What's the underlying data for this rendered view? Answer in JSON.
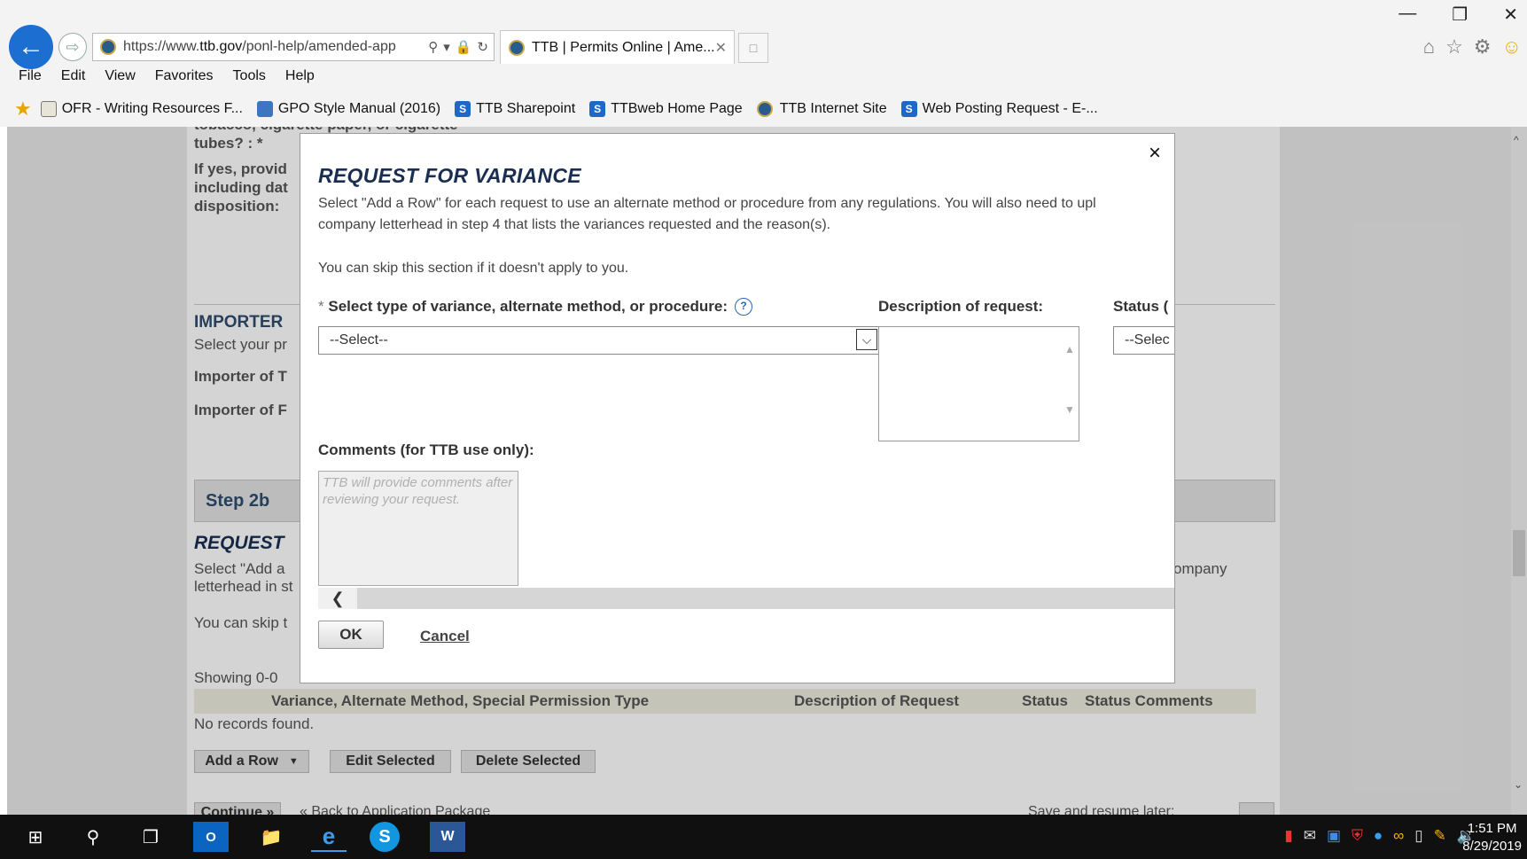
{
  "browser": {
    "url_prefix": "https://www.",
    "url_domain": "ttb.gov",
    "url_rest": "/ponl-help/amended-app",
    "tab_title": "TTB | Permits Online | Ame...",
    "tab_close": "✕",
    "menu": [
      "File",
      "Edit",
      "View",
      "Favorites",
      "Tools",
      "Help"
    ],
    "favorites": [
      {
        "label": "OFR - Writing Resources F...",
        "icon": "document-icon"
      },
      {
        "label": "GPO Style Manual (2016)",
        "icon": "gpo-icon"
      },
      {
        "label": "TTB Sharepoint",
        "icon": "sharepoint-icon"
      },
      {
        "label": "TTBweb Home Page",
        "icon": "sharepoint-icon"
      },
      {
        "label": "TTB Internet Site",
        "icon": "ttb-shield-icon"
      },
      {
        "label": "Web Posting Request - E-...",
        "icon": "sharepoint-icon"
      }
    ]
  },
  "background_page": {
    "q1a": "tobacco, cigarette paper, or cigarette",
    "q1b": "tubes? : *",
    "q2a": "If yes, provid",
    "q2b": "including dat",
    "q2c": "disposition:",
    "importer_heading": "IMPORTER",
    "importer_sub": "Select your pr",
    "importer_t": "Importer of T",
    "importer_f": "Importer of F",
    "step_label": "Step 2b",
    "request_heading": "REQUEST",
    "select_add_a": "Select \"Add a",
    "letterhead_in": "letterhead in st",
    "company_tail": "ompany",
    "skip_frag": "You can skip t",
    "showing": "Showing 0-0",
    "table_headers": [
      "Variance, Alternate Method, Special Permission Type",
      "Description of Request",
      "Status",
      "Status Comments"
    ],
    "no_records": "No records found.",
    "add_row": "Add a Row",
    "edit_selected": "Edit Selected",
    "delete_selected": "Delete Selected",
    "continue": "Continue »",
    "back_link": "« Back to Application Package",
    "save_later": "Save and resume later:"
  },
  "modal": {
    "title": "REQUEST FOR VARIANCE",
    "intro_line1": "Select \"Add a Row\" for each request to use an alternate method or procedure from any regulations. You will also need to upl",
    "intro_line2": "company letterhead in step 4 that lists the variances requested and the reason(s).",
    "skip_note": "You can skip this section if it doesn't apply to you.",
    "required_mark": "*",
    "variance_label": "Select type of variance, alternate method, or procedure:",
    "variance_value": "--Select--",
    "description_label": "Description of request:",
    "status_label": "Status (",
    "status_value": "--Selec",
    "comments_label": "Comments (for TTB use only):",
    "comments_placeholder": "TTB will provide comments after reviewing your request.",
    "ok": "OK",
    "cancel": "Cancel",
    "close": "×"
  },
  "taskbar": {
    "time": "1:51 PM",
    "date": "8/29/2019"
  }
}
